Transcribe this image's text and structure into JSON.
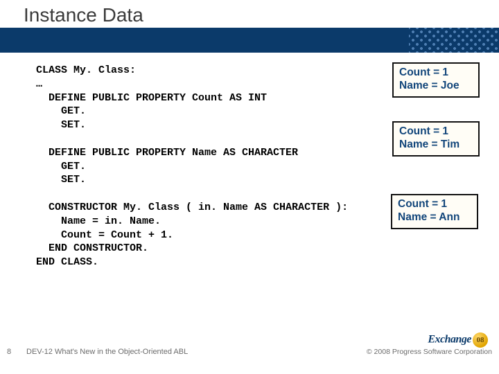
{
  "title": "Instance Data",
  "code": "CLASS My. Class:\n…\n  DEFINE PUBLIC PROPERTY Count AS INT\n    GET.\n    SET.\n\n  DEFINE PUBLIC PROPERTY Name AS CHARACTER\n    GET.\n    SET.\n\n  CONSTRUCTOR My. Class ( in. Name AS CHARACTER ):\n    Name = in. Name.\n    Count = Count + 1.\n  END CONSTRUCTOR.\nEND CLASS.",
  "boxes": {
    "b1": {
      "l1": "Count = 1",
      "l2": "Name = Joe"
    },
    "b2": {
      "l1": "Count = 1",
      "l2": "Name = Tim"
    },
    "b3": {
      "l1": "Count = 1",
      "l2": "Name = Ann"
    }
  },
  "footer": {
    "page": "8",
    "session": "DEV-12 What's New in the Object-Oriented ABL",
    "copyright": "© 2008 Progress Software Corporation"
  },
  "logo": {
    "text": "Exchange",
    "year": "08"
  }
}
